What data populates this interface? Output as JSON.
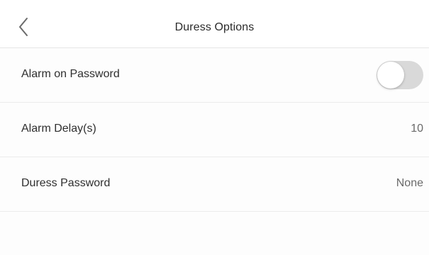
{
  "header": {
    "title": "Duress Options",
    "back_icon": "chevron-left-icon"
  },
  "settings": [
    {
      "label": "Alarm on Password",
      "type": "toggle",
      "enabled": false
    },
    {
      "label": "Alarm Delay(s)",
      "type": "value",
      "value": "10"
    },
    {
      "label": "Duress Password",
      "type": "value",
      "value": "None"
    }
  ],
  "colors": {
    "toggle_off_track": "#d9d9d9",
    "divider": "#ececec",
    "value_text": "#6a6a6a"
  }
}
